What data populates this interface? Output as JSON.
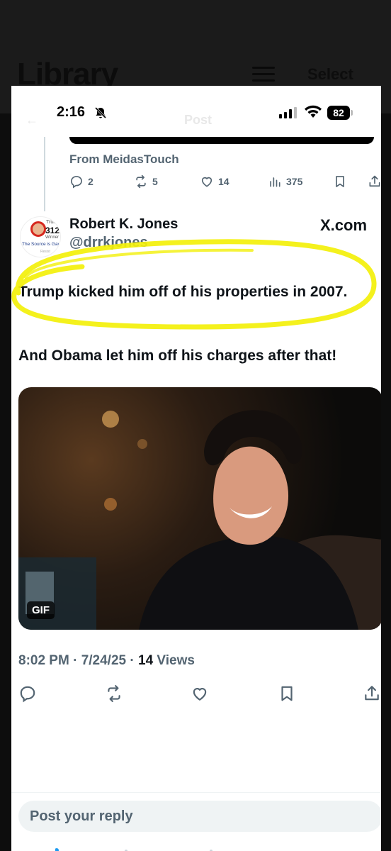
{
  "background_app": {
    "title": "Library",
    "select_label": "Select"
  },
  "status_bar": {
    "time": "2:16",
    "battery": "82"
  },
  "ghost_header": {
    "title": "Post"
  },
  "quoted_post": {
    "source_label": "From MeidasTouch",
    "replies": "2",
    "reposts": "5",
    "likes": "14",
    "views": "375"
  },
  "post": {
    "author_name": "Robert K. Jones",
    "author_handle": "@drrkjones",
    "site": "X.com",
    "avatar": {
      "top_label": "Trump",
      "number": "312",
      "winner_label": "Winner",
      "caption": "The Source is Gay",
      "bottom_label": "Resist"
    },
    "text_line_1": "Trump kicked him off of his properties in 2007.",
    "text_line_2": "And Obama let him off his charges after that!",
    "media_badge": "GIF",
    "time": "8:02 PM",
    "date": "7/24/25",
    "views_count": "14",
    "views_label": "Views"
  },
  "reply": {
    "placeholder": "Post your reply"
  },
  "colors": {
    "text_primary": "#0f1419",
    "text_secondary": "#536471",
    "highlight": "#f3f00a"
  }
}
